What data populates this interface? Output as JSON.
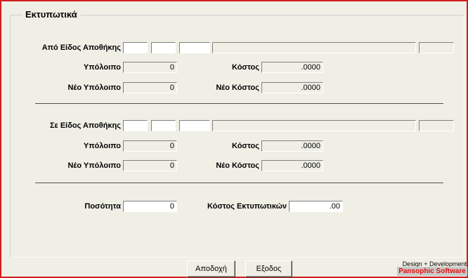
{
  "group_title": "Εκτυπωτικά",
  "from_section": {
    "label": "Από Είδος Αποθήκης",
    "balance_label": "Υπόλοιπο",
    "balance": "0",
    "cost_label": "Κόστος",
    "cost": ".0000",
    "new_balance_label": "Νέο Υπόλοιπο",
    "new_balance": "0",
    "new_cost_label": "Νέο Κόστος",
    "new_cost": ".0000"
  },
  "to_section": {
    "label": "Σε Είδος Αποθήκης",
    "balance_label": "Υπόλοιπο",
    "balance": "0",
    "cost_label": "Κόστος",
    "cost": ".0000",
    "new_balance_label": "Νέο Υπόλοιπο",
    "new_balance": "0",
    "new_cost_label": "Νέο Κόστος",
    "new_cost": ".0000"
  },
  "quantity_label": "Ποσότητα",
  "quantity": "0",
  "print_cost_label": "Κόστος Εκτυπωτικών",
  "print_cost": ".00",
  "buttons": {
    "accept": "Αποδοχή",
    "exit": "Εξοδος"
  },
  "credit": {
    "line1": "Design + Development",
    "line2": "Pansophic Software"
  },
  "colors": {
    "window_border": "#d21d1d",
    "form_bg": "#f0efe6",
    "brand": "#e01010"
  }
}
